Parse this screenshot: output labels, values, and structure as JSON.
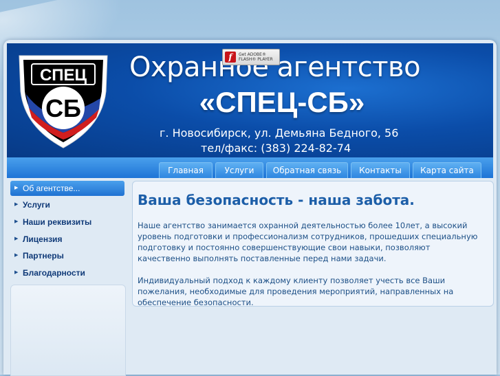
{
  "header": {
    "title_line1": "Охранное агентство",
    "title_line2": "«СПЕЦ-СБ»",
    "address": "г. Новосибирск, ул. Демьяна Бедного, 56",
    "phone": "тел/факс: (383) 224-82-74",
    "logo_text_top": "СПЕЦ",
    "logo_text_main": "СБ"
  },
  "flash_badge": {
    "line1": "Get ADOBE®",
    "line2": "FLASH® PLAYER",
    "icon": "flash-player-icon"
  },
  "nav": {
    "items": [
      "Главная",
      "Услуги",
      "Обратная связь",
      "Контакты",
      "Карта сайта"
    ]
  },
  "sidebar": {
    "items": [
      {
        "label": "Об агентстве...",
        "active": true
      },
      {
        "label": "Услуги",
        "active": false
      },
      {
        "label": "Наши реквизиты",
        "active": false
      },
      {
        "label": "Лицензия",
        "active": false
      },
      {
        "label": "Партнеры",
        "active": false
      },
      {
        "label": "Благодарности",
        "active": false
      }
    ],
    "arrow_icon": "triangle-right-icon"
  },
  "main": {
    "heading": "Ваша безопасность - наша забота.",
    "paragraph1": "Наше агентство занимается охранной деятельностью более  10лет, а высокий уровень подготовки и профессионализм сотрудников, прошедших специальную подготовку и постоянно совершенствующие свои навыки, позволяют качественно выполнять поставленные перед нами задачи.",
    "paragraph2": "Индивидуальный подход к каждому клиенту позволяет учесть все Ваши пожелания, необходимые для проведения мероприятий, направленных на обеспечение безопасности."
  },
  "colors": {
    "header_blue": "#0b4da9",
    "nav_blue": "#1e74d6",
    "heading_blue": "#1c5ea8",
    "logo_red": "#d01e1e"
  }
}
